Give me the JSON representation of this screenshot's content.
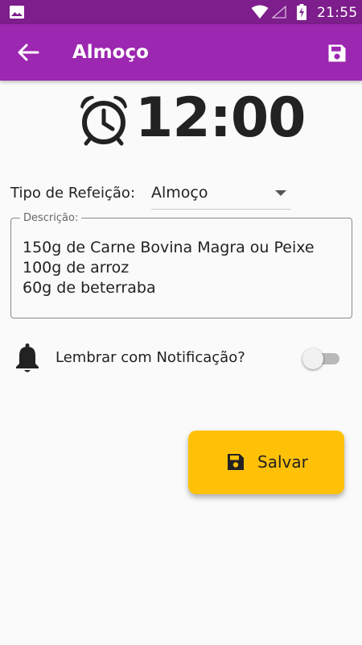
{
  "status_bar": {
    "time": "21:55",
    "icons": [
      "image-icon",
      "wifi-icon",
      "signal-icon",
      "battery-charging-icon"
    ]
  },
  "app_bar": {
    "title": "Almoço",
    "back_icon": "arrow-left-icon",
    "save_icon": "floppy-disk-icon",
    "color": "#9c27b0"
  },
  "clock": {
    "icon": "alarm-clock-icon",
    "time": "12:00"
  },
  "meal_type": {
    "label": "Tipo de Refeição:",
    "selected": "Almoço"
  },
  "description": {
    "label": "Descrição:",
    "lines": [
      "150g de Carne Bovina Magra ou Peixe",
      "100g de arroz",
      "60g de beterraba"
    ]
  },
  "notification": {
    "icon": "bell-icon",
    "label": "Lembrar com Notificação?",
    "enabled": false
  },
  "save_button": {
    "label": "Salvar",
    "icon": "floppy-disk-icon",
    "color": "#ffc107"
  }
}
